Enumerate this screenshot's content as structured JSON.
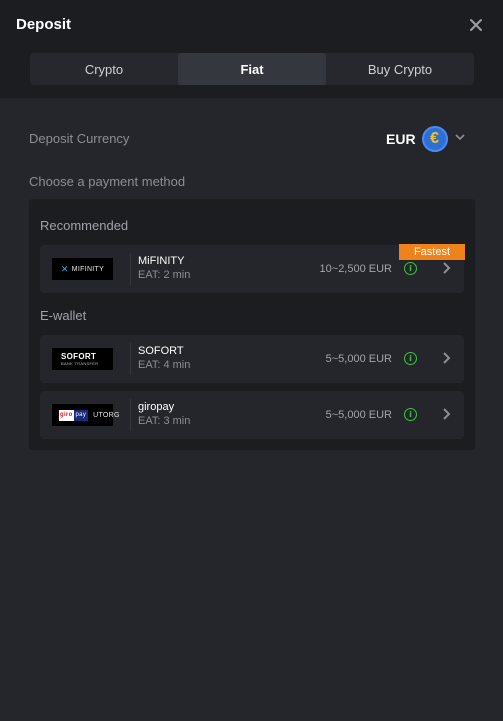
{
  "header": {
    "title": "Deposit",
    "tabs": [
      {
        "label": "Crypto",
        "active": false
      },
      {
        "label": "Fiat",
        "active": true
      },
      {
        "label": "Buy Crypto",
        "active": false
      }
    ]
  },
  "currency": {
    "label": "Deposit Currency",
    "code": "EUR",
    "icon": "euro-coin-icon",
    "coin_symbol": "€"
  },
  "methods": {
    "label": "Choose a payment method",
    "recommended": {
      "title": "Recommended",
      "items": [
        {
          "name": "MiFINITY",
          "logo_text": "MIFINITY",
          "eat": "EAT: 2 min",
          "range": "10~2,500 EUR",
          "badge": "Fastest"
        }
      ]
    },
    "ewallet": {
      "title": "E-wallet",
      "items": [
        {
          "name": "SOFORT",
          "logo_text": "SOFORT",
          "logo_subtext": "BANK TRANSFER",
          "eat": "EAT: 4 min",
          "range": "5~5,000 EUR"
        },
        {
          "name": "giropay",
          "logo_text": "giro",
          "logo_text2": "pay",
          "logo_text3": "UTORG",
          "eat": "EAT: 3 min",
          "range": "5~5,000 EUR"
        }
      ]
    }
  },
  "colors": {
    "background": "#24262b",
    "header_bg": "#1b1d21",
    "panel_bg": "#1b1d21",
    "accent_orange": "#f0821c",
    "info_green": "#3fc23f",
    "euro_blue": "#2e6fd6"
  },
  "info_icon_glyph": "i"
}
